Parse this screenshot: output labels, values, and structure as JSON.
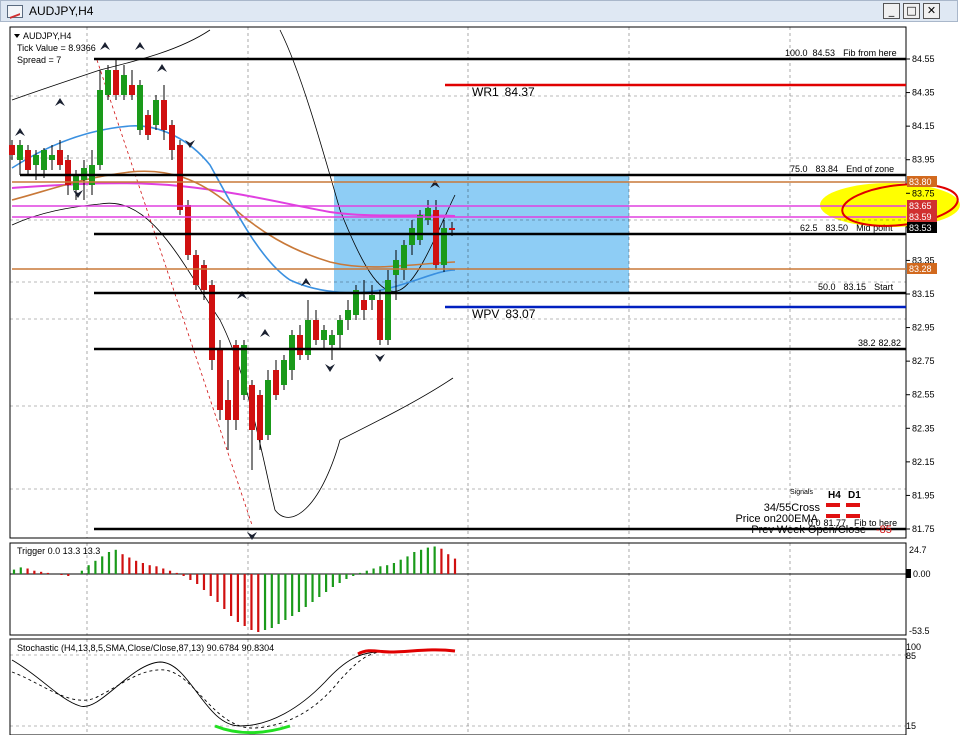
{
  "window": {
    "title": "AUDJPY,H4",
    "buttons": {
      "minimize": "_",
      "maximize": "□",
      "close": "✕"
    }
  },
  "info": {
    "symbol": "AUDJPY,H4",
    "tick_value": "Tick Value = 8.9366",
    "spread": "Spread = 7"
  },
  "price_axis": {
    "ticks": [
      "84.55",
      "84.35",
      "84.15",
      "83.95",
      "83.75",
      "83.55",
      "83.35",
      "83.15",
      "82.95",
      "82.75",
      "82.55",
      "82.35",
      "82.15",
      "81.95",
      "81.75"
    ],
    "badges": [
      {
        "label": "83.80",
        "color": "#d2691e"
      },
      {
        "label": "83.65",
        "color": "#d03030"
      },
      {
        "label": "83.59",
        "color": "#d03030"
      },
      {
        "label": "83.53",
        "color": "#000000"
      },
      {
        "label": "83.28",
        "color": "#d2691e"
      }
    ]
  },
  "fib_levels": [
    {
      "level": "100.0",
      "price": "84.53",
      "note": "Fib from here"
    },
    {
      "level": "75.0",
      "price": "83.84",
      "note": "End of zone"
    },
    {
      "level": "62.5",
      "price": "83.50",
      "note": "Mid point"
    },
    {
      "level": "50.0",
      "price": "83.15",
      "note": "Start"
    },
    {
      "level": "38.2",
      "price": "82.82",
      "note": ""
    },
    {
      "level": "0.0",
      "price": "81.77",
      "note": "Fib to here"
    }
  ],
  "pivots": {
    "wr1": {
      "label": "WR1",
      "value": "84.37",
      "color": "#e00000"
    },
    "wpv": {
      "label": "WPV",
      "value": "83.07",
      "color": "#0020c0"
    }
  },
  "signals": {
    "header": "Signals",
    "col_h4": "H4",
    "col_d1": "D1",
    "rows": [
      "34/55Cross",
      "Price on200EMA",
      "Prev Week Open/Close"
    ],
    "prev_week_value": "-85"
  },
  "trigger": {
    "label": "Trigger 0.0 13.3 13.3",
    "ticks": [
      "24.7",
      "0.00",
      "-53.5"
    ]
  },
  "stochastic": {
    "label": "Stochastic (H4,13,8,5,SMA,Close/Close,87,13) 90.6784 90.8304",
    "ticks": [
      "100",
      "85",
      "15"
    ]
  },
  "colors": {
    "bull": "#1a9a1a",
    "bear": "#d01010",
    "zone": "#8ecdf5",
    "magenta": "#e040e0",
    "orange_ma": "#c87838",
    "blue_ma": "#3a90e0",
    "highlight": "#ffff00"
  }
}
